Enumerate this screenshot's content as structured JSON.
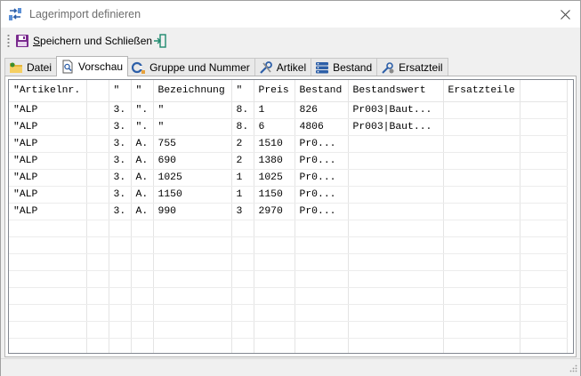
{
  "window": {
    "title": "Lagerimport definieren"
  },
  "toolbar": {
    "save_label_underlined": "S",
    "save_label_rest": "peichern und Schließen",
    "save_icon": "floppy-disk-icon",
    "exit_icon": "exit-door-icon"
  },
  "tabs": [
    {
      "label": "Datei",
      "icon": "folder-icon",
      "active": false
    },
    {
      "label": "Vorschau",
      "icon": "preview-document-icon",
      "active": true
    },
    {
      "label": "Gruppe und Nummer",
      "icon": "group-number-icon",
      "active": false
    },
    {
      "label": "Artikel",
      "icon": "tools-icon",
      "active": false
    },
    {
      "label": "Bestand",
      "icon": "database-icon",
      "active": false
    },
    {
      "label": "Ersatzteil",
      "icon": "spare-parts-icon",
      "active": false
    }
  ],
  "preview": {
    "header": [
      "\"Artikelnr.",
      "",
      "\"",
      "\"",
      "Bezeichnung",
      "\"",
      "Preis",
      "Bestand",
      "Bestandswert",
      "Ersatzteile",
      ""
    ],
    "rows": [
      [
        "\"ALP",
        "",
        "3.",
        "\".",
        "\"",
        "8.",
        "1",
        "826",
        "Pr003|Baut...",
        "",
        ""
      ],
      [
        "\"ALP",
        "",
        "3.",
        "\".",
        "\"",
        "8.",
        "6",
        "4806",
        "Pr003|Baut...",
        "",
        ""
      ],
      [
        "\"ALP",
        "",
        "3.",
        "A.",
        "755",
        "2",
        "1510",
        "Pr0...",
        "",
        "",
        ""
      ],
      [
        "\"ALP",
        "",
        "3.",
        "A.",
        "690",
        "2",
        "1380",
        "Pr0...",
        "",
        "",
        ""
      ],
      [
        "\"ALP",
        "",
        "3.",
        "A.",
        "1025",
        "1",
        "1025",
        "Pr0...",
        "",
        "",
        ""
      ],
      [
        "\"ALP",
        "",
        "3.",
        "A.",
        "1150",
        "1",
        "1150",
        "Pr0...",
        "",
        "",
        ""
      ],
      [
        "\"ALP",
        "",
        "3.",
        "A.",
        "990",
        "3",
        "2970",
        "Pr0...",
        "",
        "",
        ""
      ]
    ],
    "empty_rows": 8
  },
  "colors": {
    "title_text": "#6d6d6d",
    "save_icon": "#7a2b8e",
    "exit_icon": "#1e8a6e"
  }
}
